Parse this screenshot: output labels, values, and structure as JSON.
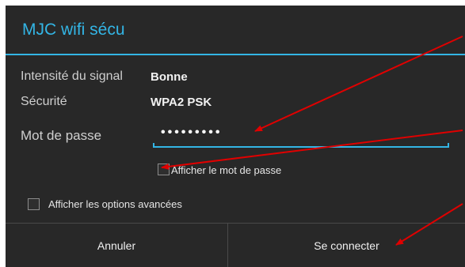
{
  "dialog": {
    "title": "MJC wifi sécu",
    "signal": {
      "label": "Intensité du signal",
      "value": "Bonne"
    },
    "security": {
      "label": "Sécurité",
      "value": "WPA2 PSK"
    },
    "password": {
      "label": "Mot de passe",
      "value": "•••••••••"
    },
    "show_password": {
      "label": "Afficher le mot de passe",
      "checked": false
    },
    "advanced_options": {
      "label": "Afficher les options avancées",
      "checked": false
    },
    "buttons": {
      "cancel": "Annuler",
      "connect": "Se connecter"
    }
  },
  "colors": {
    "accent": "#33b5e5",
    "dialog_bg": "#282828",
    "annotation_arrow": "#e00000"
  },
  "annotations": {
    "arrow_count": 3,
    "arrow_targets": [
      "password-field",
      "show-password-checkbox",
      "connect-button"
    ]
  }
}
